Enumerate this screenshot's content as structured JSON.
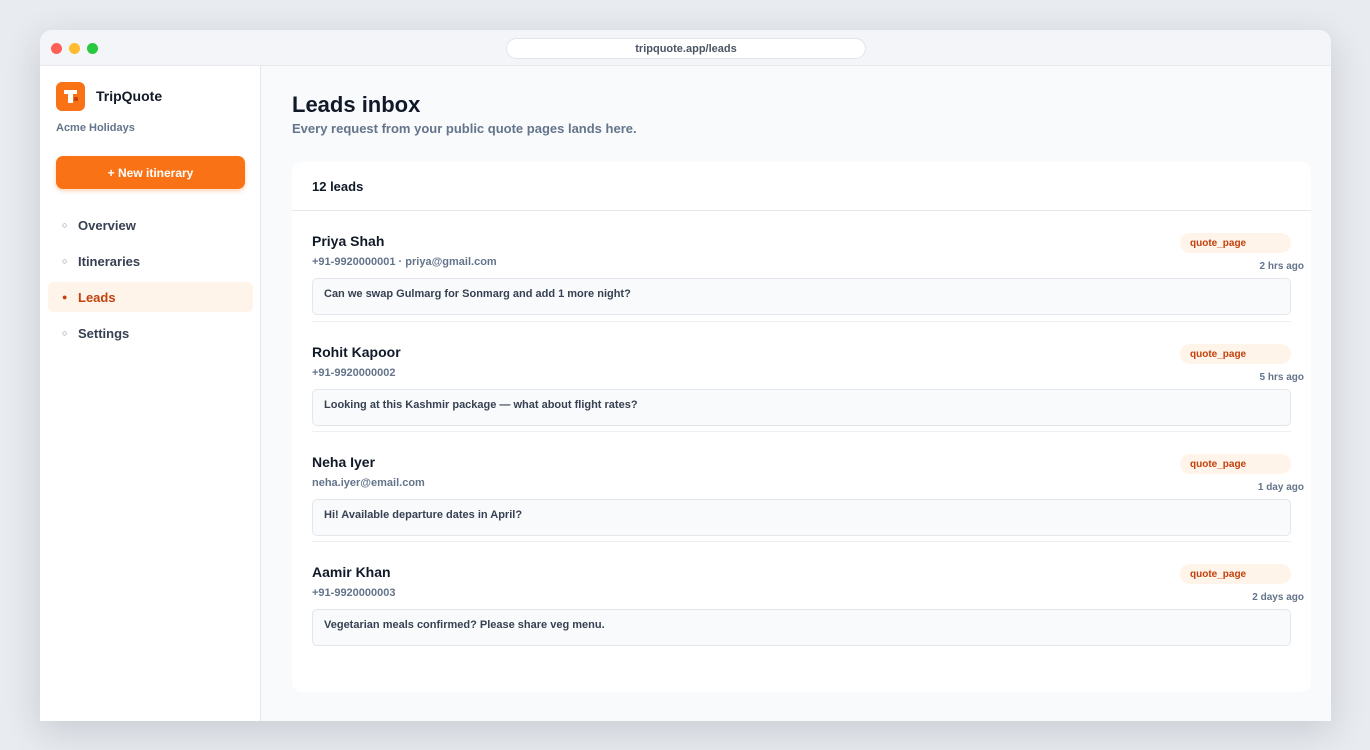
{
  "browser": {
    "url": "tripquote.app/leads"
  },
  "sidebar": {
    "brand": "TripQuote",
    "org": "Acme Holidays",
    "new_button": "+ New itinerary",
    "nav": [
      {
        "label": "Overview",
        "bullet": "○",
        "active": false
      },
      {
        "label": "Itineraries",
        "bullet": "○",
        "active": false
      },
      {
        "label": "Leads",
        "bullet": "●",
        "active": true
      },
      {
        "label": "Settings",
        "bullet": "○",
        "active": false
      }
    ]
  },
  "main": {
    "title": "Leads inbox",
    "subtitle": "Every request from your public quote pages lands here.",
    "count_label": "12 leads",
    "leads": [
      {
        "name": "Priya Shah",
        "contact": "+91-9920000001 · priya@gmail.com",
        "source": "quote_page",
        "time": "2 hrs ago",
        "message": "Can we swap Gulmarg for Sonmarg and add 1 more night?"
      },
      {
        "name": "Rohit Kapoor",
        "contact": "+91-9920000002",
        "source": "quote_page",
        "time": "5 hrs ago",
        "message": "Looking at this Kashmir package — what about flight rates?"
      },
      {
        "name": "Neha Iyer",
        "contact": "neha.iyer@email.com",
        "source": "quote_page",
        "time": "1 day ago",
        "message": "Hi! Available departure dates in April?"
      },
      {
        "name": "Aamir Khan",
        "contact": "+91-9920000003",
        "source": "quote_page",
        "time": "2 days ago",
        "message": "Vegetarian meals confirmed? Please share veg menu."
      }
    ]
  },
  "colors": {
    "accent": "#f97316",
    "accent_dark": "#c2410c",
    "accent_soft": "#fff4ea"
  }
}
